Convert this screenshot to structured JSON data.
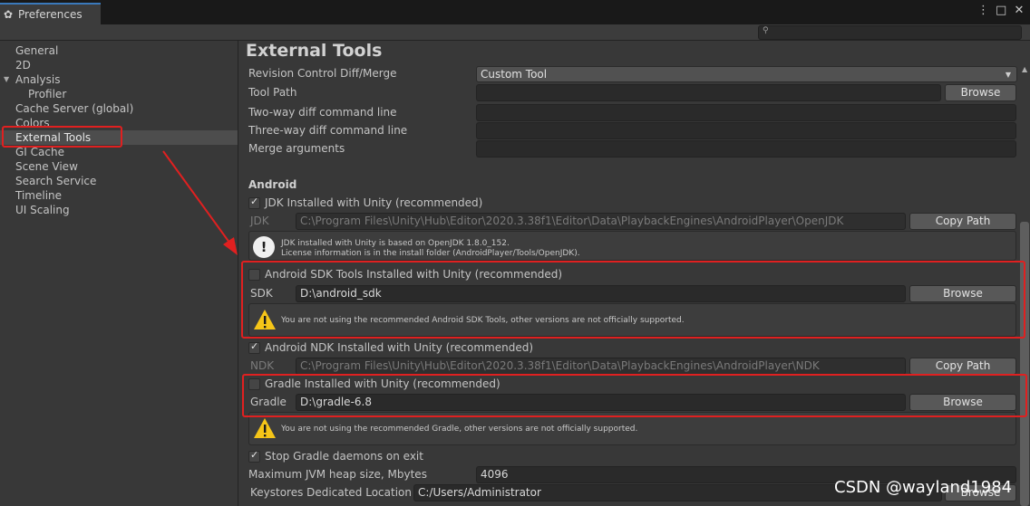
{
  "window": {
    "tab_title": "Preferences",
    "controls": [
      "⋮",
      "□",
      "✕"
    ],
    "icons": {
      "tab": "gear-icon",
      "search": "search-icon"
    }
  },
  "sidebar": {
    "items": [
      {
        "label": "General"
      },
      {
        "label": "2D"
      },
      {
        "label": "Analysis"
      },
      {
        "label": "Profiler"
      },
      {
        "label": "Cache Server (global)"
      },
      {
        "label": "Colors"
      },
      {
        "label": "External Tools"
      },
      {
        "label": "GI Cache"
      },
      {
        "label": "Scene View"
      },
      {
        "label": "Search Service"
      },
      {
        "label": "Timeline"
      },
      {
        "label": "UI Scaling"
      }
    ]
  },
  "main": {
    "title": "External Tools",
    "revision_control": {
      "label": "Revision Control Diff/Merge",
      "value": "Custom Tool"
    },
    "tool_path": {
      "label": "Tool Path",
      "value": "",
      "browse": "Browse"
    },
    "two_way": {
      "label": "Two-way diff command line",
      "value": ""
    },
    "three_way": {
      "label": "Three-way diff command line",
      "value": ""
    },
    "merge_args": {
      "label": "Merge arguments",
      "value": ""
    },
    "android": {
      "section_label": "Android",
      "jdk_check": {
        "label": "JDK Installed with Unity (recommended)",
        "checked": true
      },
      "jdk": {
        "label": "JDK",
        "value": "C:\\Program Files\\Unity\\Hub\\Editor\\2020.3.38f1\\Editor\\Data\\PlaybackEngines\\AndroidPlayer\\OpenJDK",
        "button": "Copy Path"
      },
      "jdk_info_line1": "JDK installed with Unity is based on OpenJDK 1.8.0_152.",
      "jdk_info_line2": "License information is in the install folder (AndroidPlayer/Tools/OpenJDK).",
      "sdk_check": {
        "label": "Android SDK Tools Installed with Unity (recommended)",
        "checked": false
      },
      "sdk": {
        "label": "SDK",
        "value": "D:\\android_sdk",
        "button": "Browse"
      },
      "sdk_warning": "You are not using the recommended Android SDK Tools, other versions are not officially supported.",
      "ndk_check": {
        "label": "Android NDK Installed with Unity (recommended)",
        "checked": true
      },
      "ndk": {
        "label": "NDK",
        "value": "C:\\Program Files\\Unity\\Hub\\Editor\\2020.3.38f1\\Editor\\Data\\PlaybackEngines\\AndroidPlayer\\NDK",
        "button": "Copy Path"
      },
      "gradle_check": {
        "label": "Gradle Installed with Unity (recommended)",
        "checked": false
      },
      "gradle": {
        "label": "Gradle",
        "value": "D:\\gradle-6.8",
        "button": "Browse"
      },
      "gradle_warning": "You are not using the recommended Gradle, other versions are not officially supported.",
      "stop_gradle": {
        "label": "Stop Gradle daemons on exit",
        "checked": true
      },
      "jvm_heap": {
        "label": "Maximum JVM heap size, Mbytes",
        "value": "4096"
      },
      "keystores": {
        "label": "Keystores Dedicated Location",
        "value": "C:/Users/Administrator",
        "button": "Browse"
      }
    }
  },
  "annotation": {
    "highlight_color": "#e02020"
  },
  "watermark": "CSDN @wayland1984"
}
